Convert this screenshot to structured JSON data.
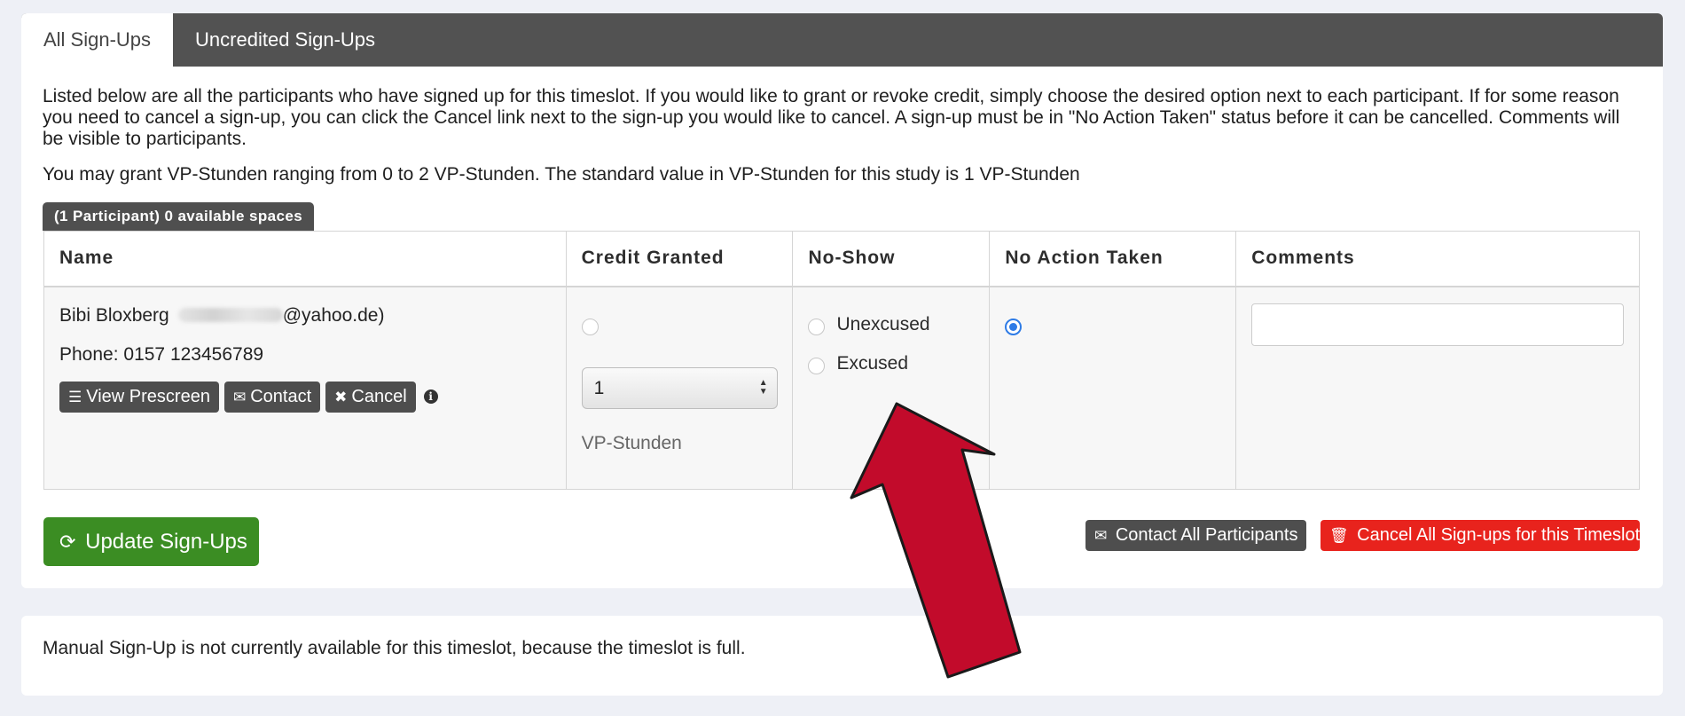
{
  "tabs": [
    {
      "label": "All Sign-Ups",
      "active": true
    },
    {
      "label": "Uncredited Sign-Ups",
      "active": false
    }
  ],
  "intro_text": "Listed below are all the participants who have signed up for this timeslot. If you would like to grant or revoke credit, simply choose the desired option next to each participant. If for some reason you need to cancel a sign-up, you can click the Cancel link next to the sign-up you would like to cancel. A sign-up must be in \"No Action Taken\" status before it can be cancelled. Comments will be visible to participants.",
  "credit_range_text": "You may grant VP-Stunden ranging from 0 to 2 VP-Stunden. The standard value in VP-Stunden for this study is 1 VP-Stunden",
  "participant_count_badge": "(1 Participant) 0 available spaces",
  "table": {
    "headers": [
      "Name",
      "Credit Granted",
      "No-Show",
      "No Action Taken",
      "Comments"
    ],
    "row": {
      "name": "Bibi Bloxberg",
      "email_suffix": "@yahoo.de)",
      "phone": "Phone: 0157 123456789",
      "buttons": {
        "view_prescreen": "View Prescreen",
        "contact": "Contact",
        "cancel": "Cancel"
      },
      "credit_value": "1",
      "credit_unit": "VP-Stunden",
      "no_show_options": [
        "Unexcused",
        "Excused"
      ],
      "selected_status": "No Action Taken",
      "comment": ""
    }
  },
  "actions": {
    "update": "Update Sign-Ups",
    "contact_all": "Contact All Participants",
    "cancel_all": "Cancel All Sign-ups for this Timeslot"
  },
  "manual_signup_text": "Manual Sign-Up is not currently available for this timeslot, because the timeslot is full.",
  "icons": {
    "list": "list-icon",
    "envelope": "envelope-icon",
    "close": "close-icon",
    "info": "info-icon",
    "refresh": "refresh-icon",
    "trash": "trash-icon"
  },
  "colors": {
    "tabbar": "#525252",
    "update_button": "#3b8d23",
    "danger_button": "#e8231d",
    "dark_button": "#4e4e4e",
    "radio_selected": "#2e7be6",
    "annotation_arrow": "#c20b2b"
  }
}
